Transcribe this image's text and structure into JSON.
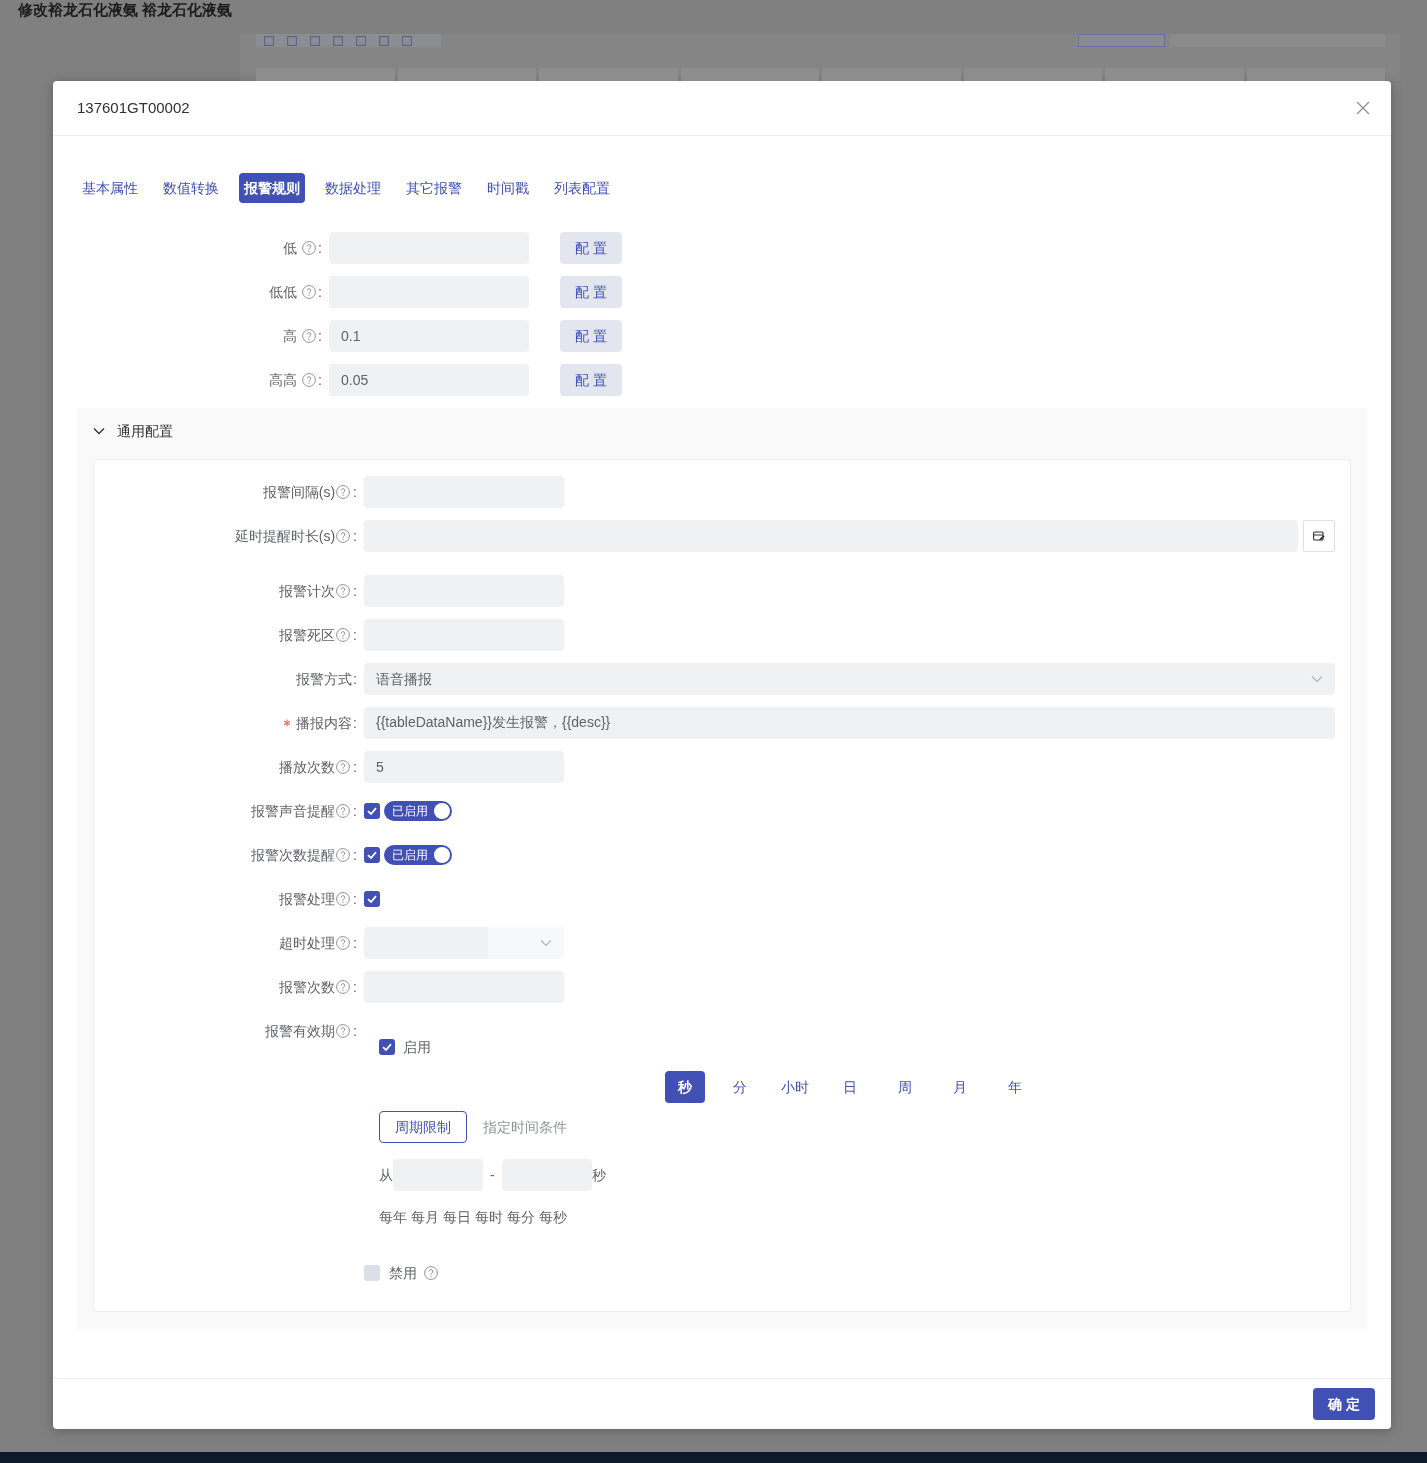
{
  "backdrop": {
    "title": "修改裕龙石化液氨 裕龙石化液氨"
  },
  "dialog": {
    "title": "137601GT00002"
  },
  "tabs": [
    {
      "label": "基本属性",
      "selected": false
    },
    {
      "label": "数值转换",
      "selected": false
    },
    {
      "label": "报警规则",
      "selected": true
    },
    {
      "label": "数据处理",
      "selected": false
    },
    {
      "label": "其它报警",
      "selected": false
    },
    {
      "label": "时间戳",
      "selected": false
    },
    {
      "label": "列表配置",
      "selected": false
    }
  ],
  "thresholds": [
    {
      "label": "低",
      "help": true,
      "colon": ":",
      "button": "配 置"
    },
    {
      "label": "低低",
      "help": true,
      "colon": ":",
      "button": "配 置"
    },
    {
      "label": "高",
      "help": true,
      "colon": ":",
      "value": "0.1",
      "button": "配 置"
    },
    {
      "label": "高高",
      "help": true,
      "colon": ":",
      "value": "0.05",
      "button": "配 置"
    }
  ],
  "general_config": {
    "title": "通用配置",
    "expanded": true,
    "fields": [
      {
        "kind": "input",
        "label": "报警间隔(s)",
        "required": false,
        "help": true,
        "colon": ":"
      },
      {
        "kind": "picker",
        "label": "延时提醒时长(s)",
        "required": false,
        "help": true,
        "colon": ":"
      },
      {
        "kind": "input",
        "label": "报警计次",
        "required": false,
        "help": true,
        "colon": ":"
      },
      {
        "kind": "input",
        "label": "报警死区",
        "required": false,
        "help": true,
        "colon": ":"
      },
      {
        "kind": "select",
        "label": "报警方式",
        "required": false,
        "help": false,
        "colon": ":",
        "value": "语音播报"
      },
      {
        "kind": "text",
        "label": "播报内容",
        "required": true,
        "help": false,
        "colon": ":",
        "value": "{{tableDataName}}发生报警，{{desc}}"
      },
      {
        "kind": "input",
        "label": "播放次数",
        "required": false,
        "help": true,
        "colon": ":",
        "value": "5"
      },
      {
        "kind": "toggle",
        "label": "报警声音提醒",
        "required": false,
        "help": true,
        "colon": ":",
        "checked": true,
        "switch": {
          "on": true,
          "label": "已启用"
        }
      },
      {
        "kind": "toggle",
        "label": "报警次数提醒",
        "required": false,
        "help": true,
        "colon": ":",
        "checked": true,
        "switch": {
          "on": true,
          "label": "已启用"
        }
      },
      {
        "kind": "checkbox",
        "label": "报警处理",
        "required": false,
        "help": true,
        "colon": ":",
        "checked": true
      },
      {
        "kind": "dropdown",
        "label": "超时处理",
        "required": false,
        "help": true,
        "colon": ":"
      },
      {
        "kind": "input",
        "label": "报警次数",
        "required": false,
        "help": true,
        "colon": ":"
      },
      {
        "kind": "validity",
        "label": "报警有效期",
        "required": false,
        "help": true,
        "colon": ":",
        "enable": {
          "label": "启用",
          "checked": true
        },
        "units": [
          {
            "label": "秒",
            "selected": true
          },
          {
            "label": "分",
            "selected": false
          },
          {
            "label": "小时",
            "selected": false
          },
          {
            "label": "日",
            "selected": false
          },
          {
            "label": "周",
            "selected": false
          },
          {
            "label": "月",
            "selected": false
          },
          {
            "label": "年",
            "selected": false
          }
        ],
        "modes": [
          {
            "label": "周期限制",
            "selected": true
          },
          {
            "label": "指定时间条件",
            "selected": false
          }
        ],
        "range": {
          "from": "从",
          "separator": "-",
          "unit": "秒"
        },
        "presets": [
          "每年",
          "每月",
          "每日",
          "每时",
          "每分",
          "每秒"
        ],
        "disable": {
          "label": "禁用",
          "checked": false,
          "disabled": true,
          "help": true
        }
      }
    ]
  },
  "footer": {
    "confirm": "确 定"
  }
}
